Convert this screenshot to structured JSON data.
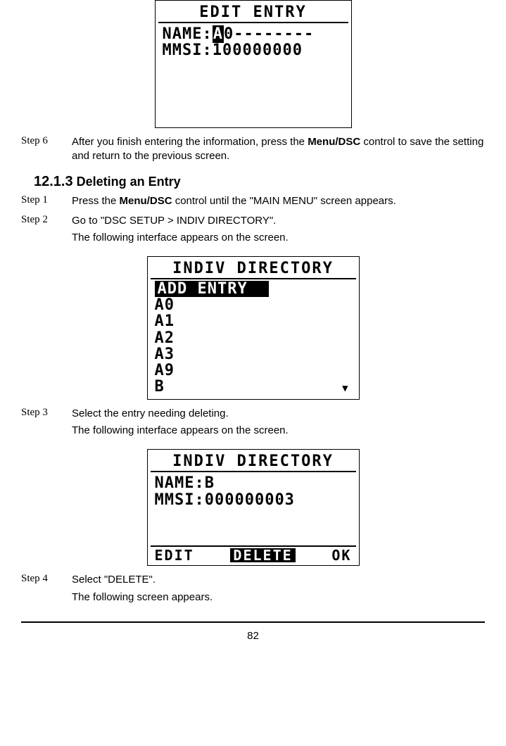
{
  "lcd1": {
    "title": "EDIT ENTRY",
    "name_label": "NAME:",
    "name_sel_char": "A",
    "name_rest": "0--------",
    "mmsi_label": "MMSI:",
    "mmsi_value": "100000000"
  },
  "step6": {
    "label": "Step 6",
    "text_pre": "After you finish entering the information, press the ",
    "text_bold": "Menu/DSC",
    "text_post": " control to save the setting and return to the previous screen."
  },
  "heading": {
    "num": "12.1.3",
    "title": " Deleting an Entry"
  },
  "step1": {
    "label": "Step 1",
    "text_pre": "Press the ",
    "text_bold": "Menu/DSC",
    "text_post": " control until the \"MAIN MENU\" screen appears."
  },
  "step2": {
    "label": "Step 2",
    "line1": "Go to \"DSC SETUP > INDIV DIRECTORY\".",
    "line2": "The following interface appears on the screen."
  },
  "lcd2": {
    "title": "INDIV DIRECTORY",
    "sel": "ADD ENTRY",
    "items": [
      "A0",
      "A1",
      "A2",
      "A3",
      "A9",
      "B"
    ]
  },
  "step3": {
    "label": "Step 3",
    "line1": "Select the entry needing deleting.",
    "line2": "The following interface appears on the screen."
  },
  "lcd3": {
    "title": "INDIV DIRECTORY",
    "name_line": "NAME:B",
    "mmsi_line": "MMSI:000000003",
    "footer_left": "EDIT",
    "footer_mid": "DELETE",
    "footer_right": "OK"
  },
  "step4": {
    "label": "Step 4",
    "line1": "Select \"DELETE\".",
    "line2": "The following screen appears."
  },
  "page_number": "82"
}
